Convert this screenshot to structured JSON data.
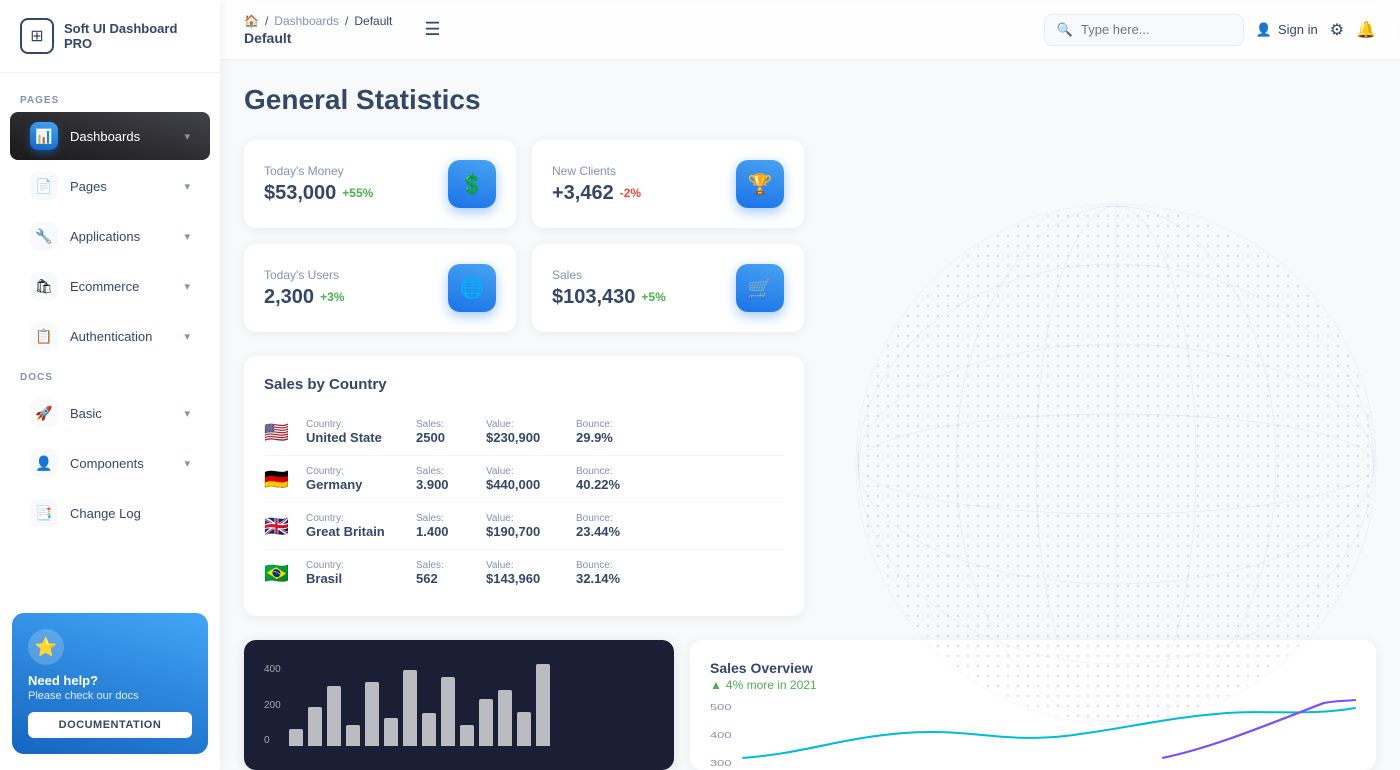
{
  "app": {
    "name": "Soft UI Dashboard PRO"
  },
  "sidebar": {
    "logo_symbol": "⊞",
    "section_pages": "PAGES",
    "section_docs": "DOCS",
    "items_pages": [
      {
        "id": "dashboards",
        "label": "Dashboards",
        "icon": "📊",
        "active": true,
        "chevron": "▾"
      },
      {
        "id": "pages",
        "label": "Pages",
        "icon": "📄",
        "active": false,
        "chevron": "▾"
      },
      {
        "id": "applications",
        "label": "Applications",
        "icon": "🔧",
        "active": false,
        "chevron": "▾"
      },
      {
        "id": "ecommerce",
        "label": "Ecommerce",
        "icon": "🛍",
        "active": false,
        "chevron": "▾"
      },
      {
        "id": "authentication",
        "label": "Authentication",
        "icon": "📋",
        "active": false,
        "chevron": "▾"
      }
    ],
    "items_docs": [
      {
        "id": "basic",
        "label": "Basic",
        "icon": "🚀",
        "active": false,
        "chevron": "▾"
      },
      {
        "id": "components",
        "label": "Components",
        "icon": "👤",
        "active": false,
        "chevron": "▾"
      },
      {
        "id": "changelog",
        "label": "Change Log",
        "icon": "📑",
        "active": false
      }
    ],
    "help": {
      "star": "⭐",
      "title": "Need help?",
      "subtitle": "Please check our docs",
      "button_label": "DOCUMENTATION"
    }
  },
  "topbar": {
    "breadcrumb_home": "🏠",
    "breadcrumb_dashboards": "Dashboards",
    "breadcrumb_current": "Default",
    "title": "Default",
    "menu_icon": "☰",
    "search_placeholder": "Type here...",
    "signin_label": "Sign in",
    "settings_icon": "⚙",
    "bell_icon": "🔔"
  },
  "main": {
    "page_title": "General Statistics",
    "stats": [
      {
        "label": "Today's Money",
        "value": "$53,000",
        "badge": "+55%",
        "badge_type": "positive",
        "icon": "$",
        "icon_color": "#1A73E8"
      },
      {
        "label": "New Clients",
        "value": "+3,462",
        "badge": "-2%",
        "badge_type": "negative",
        "icon": "🏆",
        "icon_color": "#1A73E8"
      },
      {
        "label": "Today's Users",
        "value": "2,300",
        "badge": "+3%",
        "badge_type": "positive",
        "icon": "🌐",
        "icon_color": "#1A73E8"
      },
      {
        "label": "Sales",
        "value": "$103,430",
        "badge": "+5%",
        "badge_type": "positive",
        "icon": "🛒",
        "icon_color": "#1A73E8"
      }
    ],
    "sales_by_country": {
      "title": "Sales by Country",
      "columns": [
        "Country:",
        "Sales:",
        "Value:",
        "Bounce:"
      ],
      "rows": [
        {
          "flag": "🇺🇸",
          "country": "United State",
          "sales": "2500",
          "value": "$230,900",
          "bounce": "29.9%"
        },
        {
          "flag": "🇩🇪",
          "country": "Germany",
          "sales": "3.900",
          "value": "$440,000",
          "bounce": "40.22%"
        },
        {
          "flag": "🇬🇧",
          "country": "Great Britain",
          "sales": "1.400",
          "value": "$190,700",
          "bounce": "23.44%"
        },
        {
          "flag": "🇧🇷",
          "country": "Brasil",
          "sales": "562",
          "value": "$143,960",
          "bounce": "32.14%"
        }
      ]
    },
    "bar_chart": {
      "y_labels": [
        "400",
        "200",
        "0"
      ],
      "bars": [
        15,
        35,
        55,
        20,
        60,
        25,
        70,
        30,
        65,
        20,
        45,
        55,
        35,
        80
      ]
    },
    "sales_overview": {
      "title": "Sales Overview",
      "trend": "▲ 4% more in 2021",
      "trend_color": "#4CAF50"
    }
  }
}
